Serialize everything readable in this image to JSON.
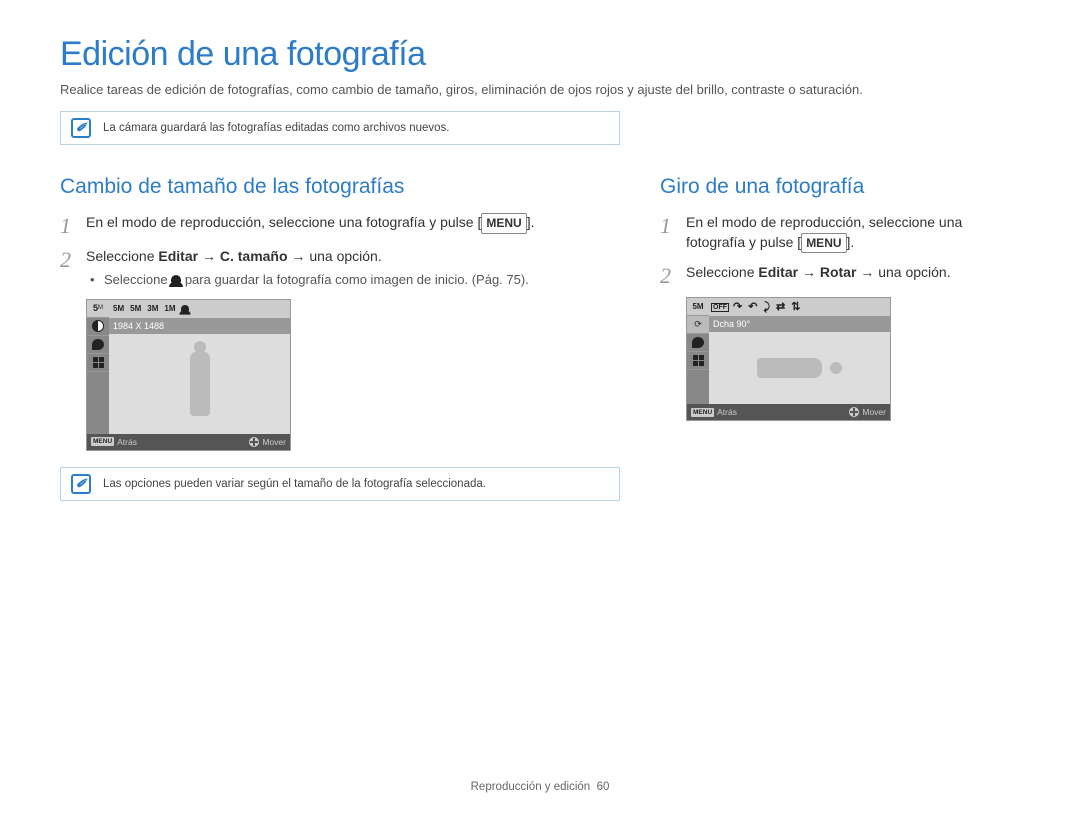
{
  "title": "Edición de una fotografía",
  "intro": "Realice tareas de edición de fotografías, como cambio de tamaño, giros, eliminación de ojos rojos y ajuste del brillo, contraste o saturación.",
  "note1": "La cámara guardará las fotografías editadas como archivos nuevos.",
  "note2": "Las opciones pueden variar según el tamaño de la fotografía seleccionada.",
  "left": {
    "heading": "Cambio de tamaño de las fotografías",
    "step1_a": "En el modo de reproducción, seleccione una fotografía y pulse [",
    "step1_menu": "MENU",
    "step1_b": "].",
    "step2_a": "Seleccione ",
    "step2_b": "Editar",
    "step2_c": " → ",
    "step2_d": "C. tamaño",
    "step2_e": " → una opción.",
    "bullet_a": "Seleccione ",
    "bullet_b": " para guardar la fotografía como imagen de inicio. (Pág. 75).",
    "screen": {
      "size_label": "1984 X 1488",
      "top_items": [
        "5M",
        "5M",
        "3M",
        "1M"
      ],
      "back": "Atrás",
      "move": "Mover",
      "menu": "MENU"
    }
  },
  "right": {
    "heading": "Giro de una fotografía",
    "step1_a": "En el modo de reproducción, seleccione una fotografía y pulse [",
    "step1_menu": "MENU",
    "step1_b": "].",
    "step2_a": "Seleccione ",
    "step2_b": "Editar",
    "step2_c": " → ",
    "step2_d": "Rotar",
    "step2_e": " → una opción.",
    "screen": {
      "rotate_label": "Dcha 90°",
      "off": "OFF",
      "back": "Atrás",
      "move": "Mover",
      "menu": "MENU",
      "sb_top": "5M"
    }
  },
  "footer": {
    "section": "Reproducción y edición",
    "page": "60"
  }
}
